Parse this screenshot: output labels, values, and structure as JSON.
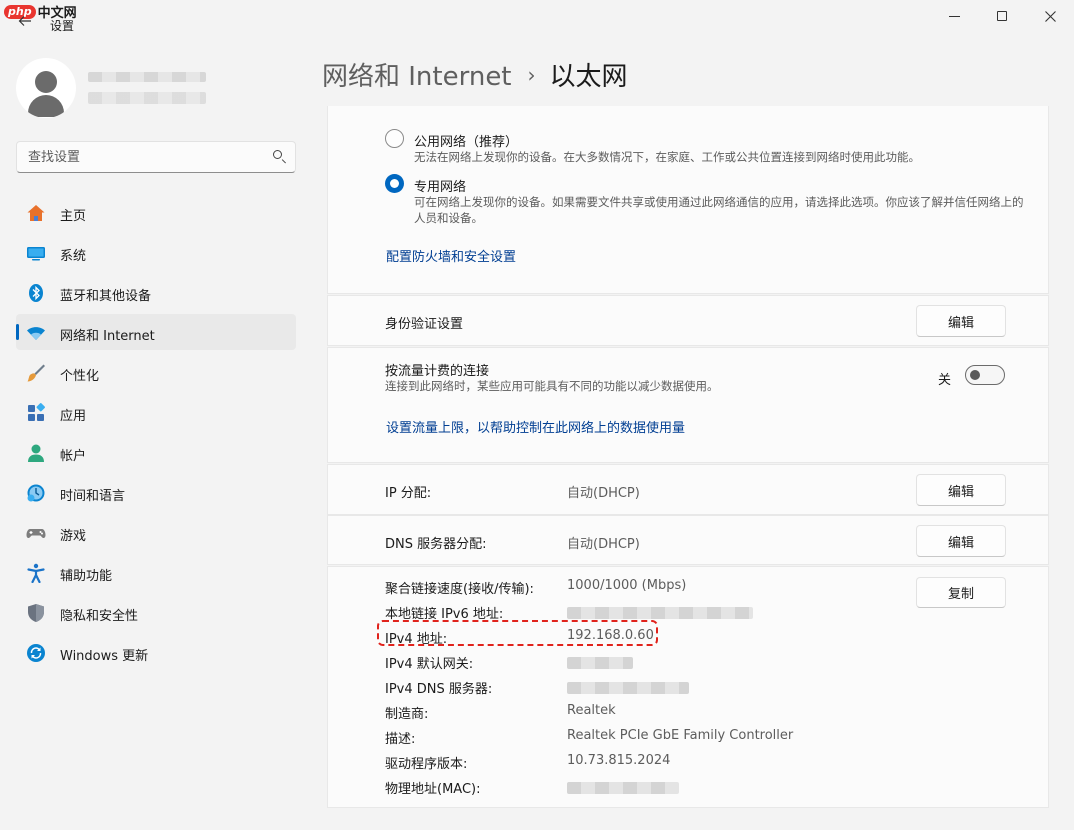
{
  "watermark": {
    "badge": "php",
    "text": "中文网"
  },
  "titlebar": {
    "app_title": "设置",
    "back_icon": "arrow-left-icon",
    "min_icon": "minimize-icon",
    "max_icon": "maximize-icon",
    "close_icon": "close-icon"
  },
  "sidebar": {
    "search_placeholder": "查找设置",
    "items": [
      {
        "label": "主页",
        "icon": "home-icon",
        "color": "#e8712b"
      },
      {
        "label": "系统",
        "icon": "system-icon",
        "color": "#0a84d0"
      },
      {
        "label": "蓝牙和其他设备",
        "icon": "bluetooth-icon",
        "color": "#0a84d0"
      },
      {
        "label": "网络和 Internet",
        "icon": "wifi-icon",
        "color": "#0a84d0",
        "active": true
      },
      {
        "label": "个性化",
        "icon": "brush-icon",
        "color": "#e59a3b"
      },
      {
        "label": "应用",
        "icon": "apps-icon",
        "color": "#3a6fb4"
      },
      {
        "label": "帐户",
        "icon": "account-icon",
        "color": "#2ea87f"
      },
      {
        "label": "时间和语言",
        "icon": "clock-globe-icon",
        "color": "#0a84d0"
      },
      {
        "label": "游戏",
        "icon": "gamepad-icon",
        "color": "#6b6b6b"
      },
      {
        "label": "辅助功能",
        "icon": "accessibility-icon",
        "color": "#1a73c8"
      },
      {
        "label": "隐私和安全性",
        "icon": "shield-icon",
        "color": "#6b6b6b"
      },
      {
        "label": "Windows 更新",
        "icon": "update-icon",
        "color": "#0a84d0"
      }
    ]
  },
  "header": {
    "parent": "网络和 Internet",
    "separator": "›",
    "current": "以太网"
  },
  "profile": {
    "public": {
      "title": "公用网络（推荐）",
      "desc": "无法在网络上发现你的设备。在大多数情况下，在家庭、工作或公共位置连接到网络时使用此功能。",
      "selected": false
    },
    "private": {
      "title": "专用网络",
      "desc": "可在网络上发现你的设备。如果需要文件共享或使用通过此网络通信的应用，请选择此选项。你应该了解并信任网络上的人员和设备。",
      "selected": true
    },
    "firewall_link": "配置防火墙和安全设置"
  },
  "auth": {
    "label": "身份验证设置",
    "button": "编辑"
  },
  "metered": {
    "label": "按流量计费的连接",
    "desc": "连接到此网络时，某些应用可能具有不同的功能以减少数据使用。",
    "toggle_state": "关",
    "toggle_on": false,
    "link": "设置流量上限，以帮助控制在此网络上的数据使用量"
  },
  "ip": {
    "label": "IP 分配:",
    "value": "自动(DHCP)",
    "button": "编辑"
  },
  "dns": {
    "label": "DNS 服务器分配:",
    "value": "自动(DHCP)",
    "button": "编辑"
  },
  "details": {
    "copy_button": "复制",
    "rows": [
      {
        "label": "聚合链接速度(接收/传输):",
        "value": "1000/1000 (Mbps)"
      },
      {
        "label": "本地链接 IPv6 地址:",
        "value": "",
        "redacted": true
      },
      {
        "label": "IPv4 地址:",
        "value": "192.168.0.60"
      },
      {
        "label": "IPv4 默认网关:",
        "value": "",
        "redacted": true
      },
      {
        "label": "IPv4 DNS 服务器:",
        "value": "",
        "redacted": true
      },
      {
        "label": "制造商:",
        "value": "Realtek"
      },
      {
        "label": "描述:",
        "value": "Realtek PCIe GbE Family Controller"
      },
      {
        "label": "驱动程序版本:",
        "value": "10.73.815.2024"
      },
      {
        "label": "物理地址(MAC):",
        "value": "",
        "redacted": true
      }
    ]
  },
  "colors": {
    "accent": "#0067c0",
    "link": "#003e92",
    "highlight": "#e0231c"
  }
}
